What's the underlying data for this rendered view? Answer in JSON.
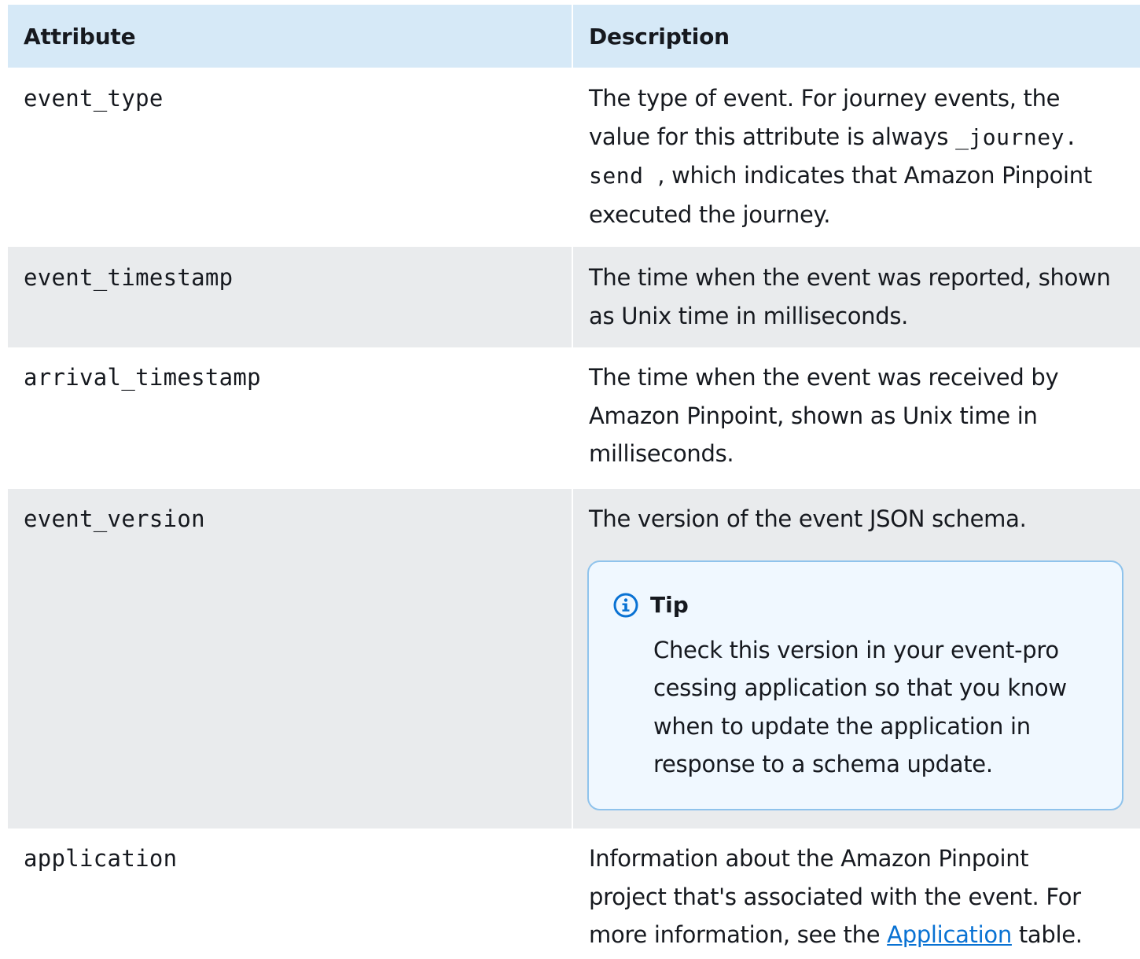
{
  "header": {
    "attribute": "Attribute",
    "description": "Description"
  },
  "rows": [
    {
      "attribute": "event_type",
      "desc_part1": "The type of event. For journey events, the value for this attribute is always ",
      "desc_code_a": "_journey.",
      "desc_code_b": "send",
      "desc_part2": ", which indicates that Amazon Pinpoint executed the journey."
    },
    {
      "attribute": "event_timestamp",
      "description": "The time when the event was reported, shown as Unix time in milliseconds."
    },
    {
      "attribute": "arrival_timestamp",
      "description": "The time when the event was received by Amazon Pinpoint, shown as Unix time in milliseconds."
    },
    {
      "attribute": "event_version",
      "description": "The version of the event JSON schema.",
      "tip": {
        "title": "Tip",
        "body": "Check this version in your event-pro cessing application so that you know when to update the application in response to a schema update."
      }
    },
    {
      "attribute": "application",
      "desc_part1": "Information about the Amazon Pinpoint project that's associated with the event. For more information, see the ",
      "desc_link": "Application",
      "desc_part2": " table."
    }
  ],
  "colors": {
    "header_bg": "#d6e9f7",
    "stripe_bg": "#e9ebed",
    "tip_bg": "#f0f8ff",
    "tip_border": "#8fc3ec",
    "info_icon": "#0972d3",
    "link": "#0972d3"
  },
  "icons": {
    "tip": "info-circle-icon"
  }
}
